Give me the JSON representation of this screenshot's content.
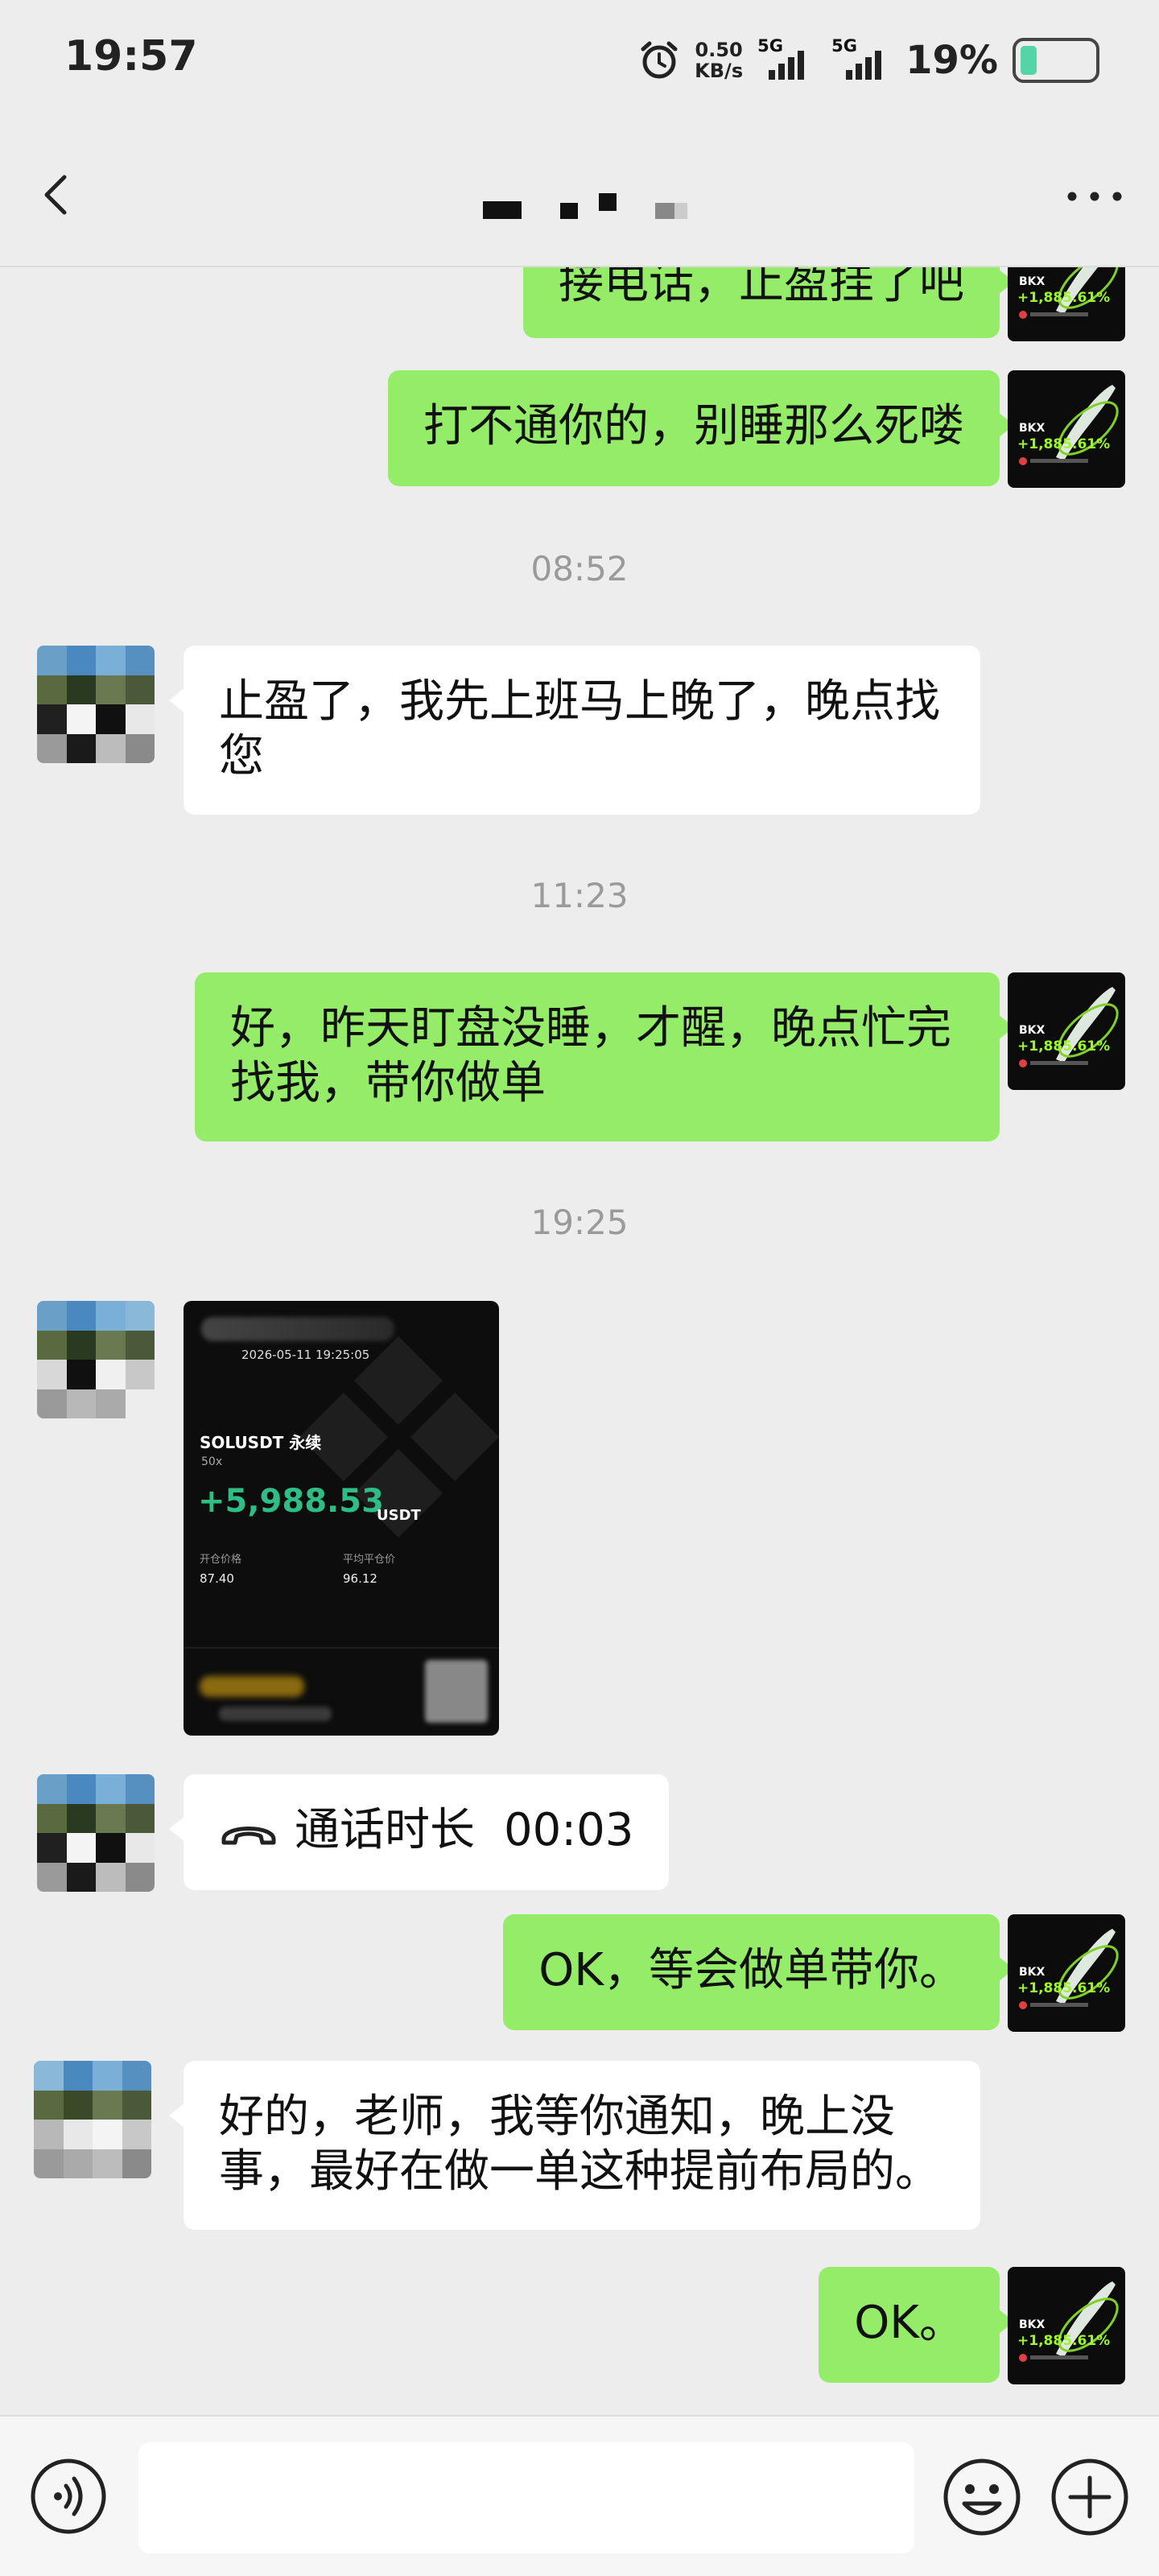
{
  "status_bar": {
    "time": "19:57",
    "net_speed_value": "0.50",
    "net_speed_unit": "KB/s",
    "sim1_label": "5G",
    "sim2_label": "5G",
    "battery_percent": "19%"
  },
  "nav": {
    "back_icon": "chevron-left-icon",
    "more_icon": "more-dots-icon"
  },
  "messages": {
    "m1_text": "接电话，止盈挂了吧",
    "m2_text": "打不通你的，别睡那么死喽",
    "ts1": "08:52",
    "m3_text": "止盈了，我先上班马上晚了，晚点找您",
    "ts2": "11:23",
    "m4_text": "好，昨天盯盘没睡，才醒，晚点忙完找我，带你做单",
    "ts3": "19:25",
    "call_label": "通话时长",
    "call_duration": "00:03",
    "m6_text": "OK，等会做单带你。",
    "m7_text": "好的，老师，我等你通知，晚上没事，最好在做一单这种提前布局的。",
    "m8_text": "OK。"
  },
  "my_avatar": {
    "brand": "BKX",
    "pct": "+1,885.61%"
  },
  "trade_card": {
    "datetime": "2026-05-11 19:25:05",
    "pair": "SOLUSDT 永续",
    "leverage": "50x",
    "pnl": "+5,988.53",
    "unit": "USDT",
    "open_price_label": "开仓价格",
    "open_price": "87.40",
    "avg_close_label": "平均平仓价",
    "avg_close": "96.12",
    "pnl_color": "#2ebd85"
  },
  "colors": {
    "my_bubble": "#95ec69",
    "other_bubble": "#ffffff",
    "background": "#ededed"
  }
}
